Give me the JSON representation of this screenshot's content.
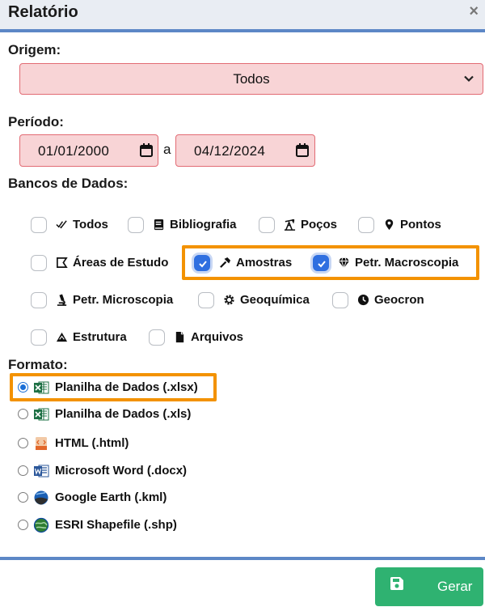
{
  "dialog": {
    "title": "Relatório",
    "close": "×"
  },
  "origem": {
    "label": "Origem:",
    "selected": "Todos"
  },
  "periodo": {
    "label": "Período:",
    "start": "01/01/2000",
    "separator": "a",
    "end": "04/12/2024"
  },
  "bancos": {
    "label": "Bancos de Dados:",
    "items": [
      {
        "label": "Todos",
        "icon": "check-double-icon",
        "checked": false
      },
      {
        "label": "Bibliografia",
        "icon": "book-icon",
        "checked": false
      },
      {
        "label": "Poços",
        "icon": "oil-well-icon",
        "checked": false
      },
      {
        "label": "Pontos",
        "icon": "map-marker-icon",
        "checked": false
      },
      {
        "label": "Áreas de Estudo",
        "icon": "area-icon",
        "checked": false
      },
      {
        "label": "Amostras",
        "icon": "hammer-icon",
        "checked": true
      },
      {
        "label": "Petr. Macroscopia",
        "icon": "gem-icon",
        "checked": true
      },
      {
        "label": "Petr. Microscopia",
        "icon": "microscope-icon",
        "checked": false
      },
      {
        "label": "Geoquímica",
        "icon": "cog-icon",
        "checked": false
      },
      {
        "label": "Geocron",
        "icon": "clock-icon",
        "checked": false
      },
      {
        "label": "Estrutura",
        "icon": "triangle-icon",
        "checked": false
      },
      {
        "label": "Arquivos",
        "icon": "file-icon",
        "checked": false
      }
    ]
  },
  "formato": {
    "label": "Formato:",
    "options": [
      {
        "label": "Planilha de Dados (.xlsx)",
        "icon": "excel-icon",
        "selected": true
      },
      {
        "label": "Planilha de Dados (.xls)",
        "icon": "excel-icon",
        "selected": false
      },
      {
        "label": "HTML (.html)",
        "icon": "html-file-icon",
        "selected": false
      },
      {
        "label": "Microsoft Word (.docx)",
        "icon": "word-icon",
        "selected": false
      },
      {
        "label": "Google Earth (.kml)",
        "icon": "google-earth-icon",
        "selected": false
      },
      {
        "label": "ESRI Shapefile (.shp)",
        "icon": "esri-globe-icon",
        "selected": false
      }
    ]
  },
  "footer": {
    "button_label": "Gerar"
  },
  "colors": {
    "accent": "#5c87c6",
    "highlight": "#f39200",
    "invalid_bg": "#f8d4d6",
    "invalid_border": "#e26b74",
    "button": "#2fb271",
    "checked": "#2f6fe0"
  }
}
